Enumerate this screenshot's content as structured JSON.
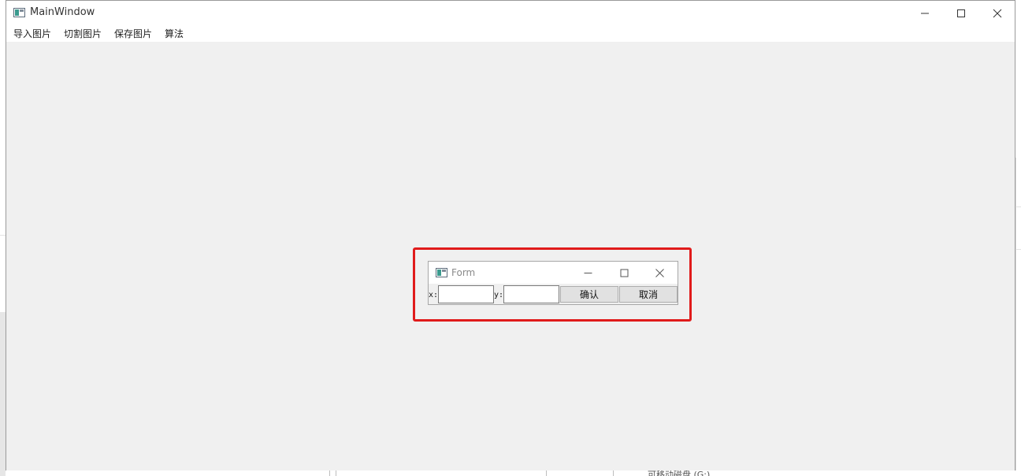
{
  "main_window": {
    "title": "MainWindow",
    "controls": {
      "minimize_icon": "minimize-icon",
      "maximize_icon": "maximize-icon",
      "close_icon": "close-icon"
    },
    "menu": [
      {
        "label": "导入图片"
      },
      {
        "label": "切割图片"
      },
      {
        "label": "保存图片"
      },
      {
        "label": "算法"
      }
    ]
  },
  "form_window": {
    "title": "Form",
    "x_label": "x:",
    "x_value": "",
    "y_label": "y:",
    "y_value": "",
    "confirm_label": "确认",
    "cancel_label": "取消"
  },
  "background": {
    "partial_text": "可移动磁盘 (G:)"
  },
  "colors": {
    "highlight": "#e01b1b",
    "window_bg": "#f0f0f0",
    "titlebar_bg": "#ffffff"
  }
}
